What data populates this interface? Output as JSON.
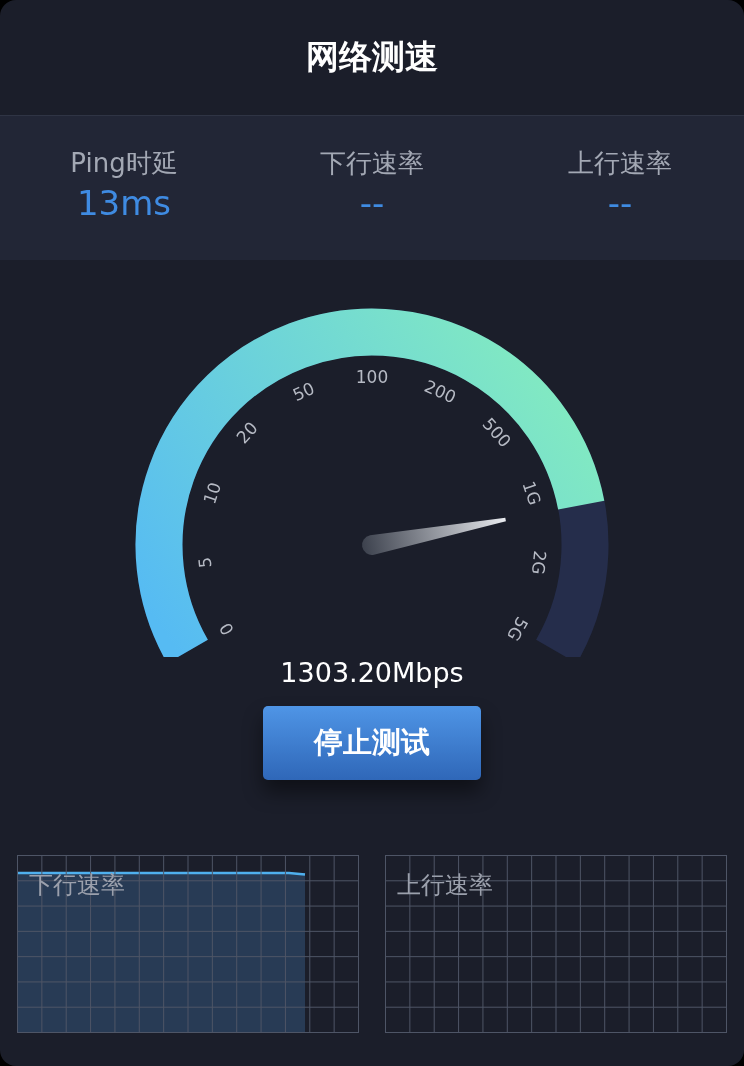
{
  "title": "网络测速",
  "stats": [
    {
      "label": "Ping时延",
      "value": "13ms"
    },
    {
      "label": "下行速率",
      "value": "--"
    },
    {
      "label": "上行速率",
      "value": "--"
    }
  ],
  "gauge": {
    "scale": [
      "0",
      "5",
      "10",
      "20",
      "50",
      "100",
      "200",
      "500",
      "1G",
      "2G",
      "5G"
    ],
    "reading": "1303.20Mbps"
  },
  "button": "停止测试",
  "charts": [
    {
      "label": "下行速率"
    },
    {
      "label": "上行速率"
    }
  ]
}
